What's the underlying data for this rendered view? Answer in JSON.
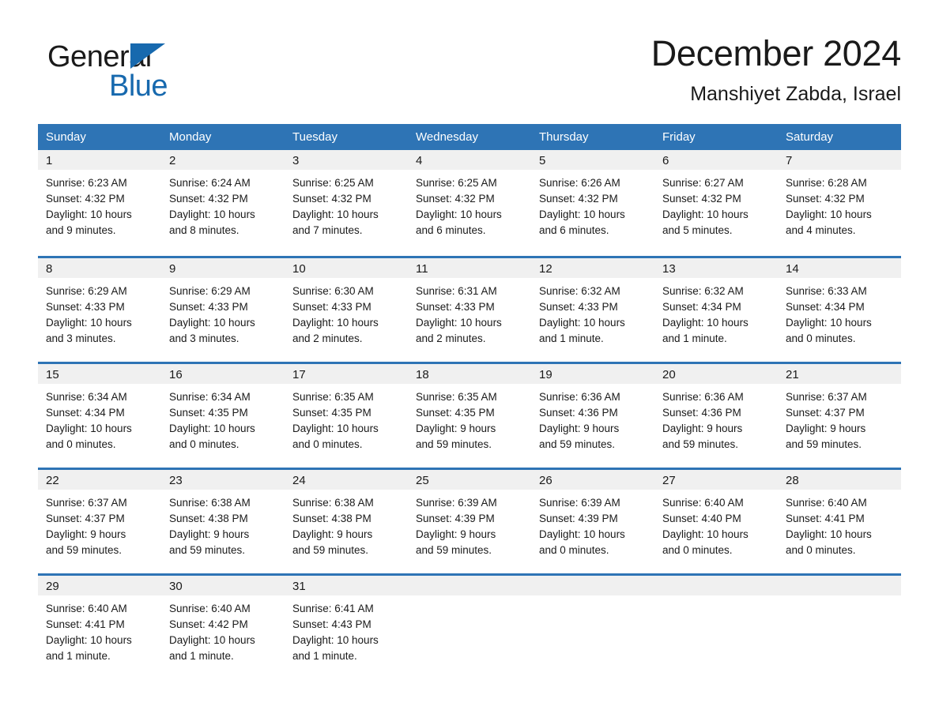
{
  "brand": {
    "name_part1": "General",
    "name_part2": "Blue",
    "triangle_color": "#1769AE"
  },
  "header": {
    "title": "December 2024",
    "subtitle": "Manshiyet Zabda, Israel"
  },
  "theme": {
    "header_blue": "#2E74B5",
    "row_divider_blue": "#2E74B5",
    "daynum_band": "#F0F0F0",
    "text": "#1a1a1a"
  },
  "calendar": {
    "weekday_headers": [
      "Sunday",
      "Monday",
      "Tuesday",
      "Wednesday",
      "Thursday",
      "Friday",
      "Saturday"
    ],
    "weeks": [
      [
        {
          "day": "1",
          "sunrise": "Sunrise: 6:23 AM",
          "sunset": "Sunset: 4:32 PM",
          "daylight_1": "Daylight: 10 hours",
          "daylight_2": "and 9 minutes."
        },
        {
          "day": "2",
          "sunrise": "Sunrise: 6:24 AM",
          "sunset": "Sunset: 4:32 PM",
          "daylight_1": "Daylight: 10 hours",
          "daylight_2": "and 8 minutes."
        },
        {
          "day": "3",
          "sunrise": "Sunrise: 6:25 AM",
          "sunset": "Sunset: 4:32 PM",
          "daylight_1": "Daylight: 10 hours",
          "daylight_2": "and 7 minutes."
        },
        {
          "day": "4",
          "sunrise": "Sunrise: 6:25 AM",
          "sunset": "Sunset: 4:32 PM",
          "daylight_1": "Daylight: 10 hours",
          "daylight_2": "and 6 minutes."
        },
        {
          "day": "5",
          "sunrise": "Sunrise: 6:26 AM",
          "sunset": "Sunset: 4:32 PM",
          "daylight_1": "Daylight: 10 hours",
          "daylight_2": "and 6 minutes."
        },
        {
          "day": "6",
          "sunrise": "Sunrise: 6:27 AM",
          "sunset": "Sunset: 4:32 PM",
          "daylight_1": "Daylight: 10 hours",
          "daylight_2": "and 5 minutes."
        },
        {
          "day": "7",
          "sunrise": "Sunrise: 6:28 AM",
          "sunset": "Sunset: 4:32 PM",
          "daylight_1": "Daylight: 10 hours",
          "daylight_2": "and 4 minutes."
        }
      ],
      [
        {
          "day": "8",
          "sunrise": "Sunrise: 6:29 AM",
          "sunset": "Sunset: 4:33 PM",
          "daylight_1": "Daylight: 10 hours",
          "daylight_2": "and 3 minutes."
        },
        {
          "day": "9",
          "sunrise": "Sunrise: 6:29 AM",
          "sunset": "Sunset: 4:33 PM",
          "daylight_1": "Daylight: 10 hours",
          "daylight_2": "and 3 minutes."
        },
        {
          "day": "10",
          "sunrise": "Sunrise: 6:30 AM",
          "sunset": "Sunset: 4:33 PM",
          "daylight_1": "Daylight: 10 hours",
          "daylight_2": "and 2 minutes."
        },
        {
          "day": "11",
          "sunrise": "Sunrise: 6:31 AM",
          "sunset": "Sunset: 4:33 PM",
          "daylight_1": "Daylight: 10 hours",
          "daylight_2": "and 2 minutes."
        },
        {
          "day": "12",
          "sunrise": "Sunrise: 6:32 AM",
          "sunset": "Sunset: 4:33 PM",
          "daylight_1": "Daylight: 10 hours",
          "daylight_2": "and 1 minute."
        },
        {
          "day": "13",
          "sunrise": "Sunrise: 6:32 AM",
          "sunset": "Sunset: 4:34 PM",
          "daylight_1": "Daylight: 10 hours",
          "daylight_2": "and 1 minute."
        },
        {
          "day": "14",
          "sunrise": "Sunrise: 6:33 AM",
          "sunset": "Sunset: 4:34 PM",
          "daylight_1": "Daylight: 10 hours",
          "daylight_2": "and 0 minutes."
        }
      ],
      [
        {
          "day": "15",
          "sunrise": "Sunrise: 6:34 AM",
          "sunset": "Sunset: 4:34 PM",
          "daylight_1": "Daylight: 10 hours",
          "daylight_2": "and 0 minutes."
        },
        {
          "day": "16",
          "sunrise": "Sunrise: 6:34 AM",
          "sunset": "Sunset: 4:35 PM",
          "daylight_1": "Daylight: 10 hours",
          "daylight_2": "and 0 minutes."
        },
        {
          "day": "17",
          "sunrise": "Sunrise: 6:35 AM",
          "sunset": "Sunset: 4:35 PM",
          "daylight_1": "Daylight: 10 hours",
          "daylight_2": "and 0 minutes."
        },
        {
          "day": "18",
          "sunrise": "Sunrise: 6:35 AM",
          "sunset": "Sunset: 4:35 PM",
          "daylight_1": "Daylight: 9 hours",
          "daylight_2": "and 59 minutes."
        },
        {
          "day": "19",
          "sunrise": "Sunrise: 6:36 AM",
          "sunset": "Sunset: 4:36 PM",
          "daylight_1": "Daylight: 9 hours",
          "daylight_2": "and 59 minutes."
        },
        {
          "day": "20",
          "sunrise": "Sunrise: 6:36 AM",
          "sunset": "Sunset: 4:36 PM",
          "daylight_1": "Daylight: 9 hours",
          "daylight_2": "and 59 minutes."
        },
        {
          "day": "21",
          "sunrise": "Sunrise: 6:37 AM",
          "sunset": "Sunset: 4:37 PM",
          "daylight_1": "Daylight: 9 hours",
          "daylight_2": "and 59 minutes."
        }
      ],
      [
        {
          "day": "22",
          "sunrise": "Sunrise: 6:37 AM",
          "sunset": "Sunset: 4:37 PM",
          "daylight_1": "Daylight: 9 hours",
          "daylight_2": "and 59 minutes."
        },
        {
          "day": "23",
          "sunrise": "Sunrise: 6:38 AM",
          "sunset": "Sunset: 4:38 PM",
          "daylight_1": "Daylight: 9 hours",
          "daylight_2": "and 59 minutes."
        },
        {
          "day": "24",
          "sunrise": "Sunrise: 6:38 AM",
          "sunset": "Sunset: 4:38 PM",
          "daylight_1": "Daylight: 9 hours",
          "daylight_2": "and 59 minutes."
        },
        {
          "day": "25",
          "sunrise": "Sunrise: 6:39 AM",
          "sunset": "Sunset: 4:39 PM",
          "daylight_1": "Daylight: 9 hours",
          "daylight_2": "and 59 minutes."
        },
        {
          "day": "26",
          "sunrise": "Sunrise: 6:39 AM",
          "sunset": "Sunset: 4:39 PM",
          "daylight_1": "Daylight: 10 hours",
          "daylight_2": "and 0 minutes."
        },
        {
          "day": "27",
          "sunrise": "Sunrise: 6:40 AM",
          "sunset": "Sunset: 4:40 PM",
          "daylight_1": "Daylight: 10 hours",
          "daylight_2": "and 0 minutes."
        },
        {
          "day": "28",
          "sunrise": "Sunrise: 6:40 AM",
          "sunset": "Sunset: 4:41 PM",
          "daylight_1": "Daylight: 10 hours",
          "daylight_2": "and 0 minutes."
        }
      ],
      [
        {
          "day": "29",
          "sunrise": "Sunrise: 6:40 AM",
          "sunset": "Sunset: 4:41 PM",
          "daylight_1": "Daylight: 10 hours",
          "daylight_2": "and 1 minute."
        },
        {
          "day": "30",
          "sunrise": "Sunrise: 6:40 AM",
          "sunset": "Sunset: 4:42 PM",
          "daylight_1": "Daylight: 10 hours",
          "daylight_2": "and 1 minute."
        },
        {
          "day": "31",
          "sunrise": "Sunrise: 6:41 AM",
          "sunset": "Sunset: 4:43 PM",
          "daylight_1": "Daylight: 10 hours",
          "daylight_2": "and 1 minute."
        },
        {
          "day": "",
          "sunrise": "",
          "sunset": "",
          "daylight_1": "",
          "daylight_2": ""
        },
        {
          "day": "",
          "sunrise": "",
          "sunset": "",
          "daylight_1": "",
          "daylight_2": ""
        },
        {
          "day": "",
          "sunrise": "",
          "sunset": "",
          "daylight_1": "",
          "daylight_2": ""
        },
        {
          "day": "",
          "sunrise": "",
          "sunset": "",
          "daylight_1": "",
          "daylight_2": ""
        }
      ]
    ]
  }
}
